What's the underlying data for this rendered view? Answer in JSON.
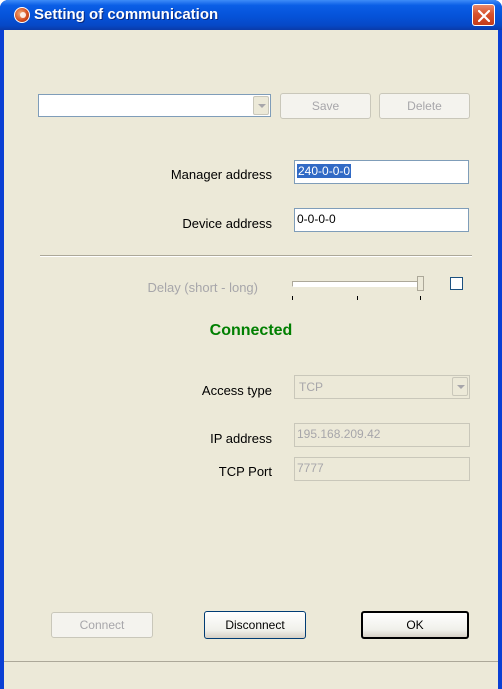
{
  "window": {
    "title": "Setting of communication"
  },
  "toolbar": {
    "profile_value": "",
    "save_label": "Save",
    "delete_label": "Delete"
  },
  "form": {
    "manager_address_label": "Manager address",
    "manager_address_value": "240-0-0-0",
    "device_address_label": "Device address",
    "device_address_value": "0-0-0-0",
    "delay_label": "Delay (short - long)",
    "delay_level": 1.0,
    "delay_checked": false,
    "status": "Connected",
    "access_type_label": "Access type",
    "access_type_value": "TCP",
    "ip_label": "IP address",
    "ip_value": "195.168.209.42",
    "tcp_port_label": "TCP Port",
    "tcp_port_value": "7777"
  },
  "footer": {
    "connect_label": "Connect",
    "disconnect_label": "Disconnect",
    "ok_label": "OK"
  },
  "colors": {
    "titlebar": "#0552d8",
    "dialog_bg": "#ece9d8",
    "status": "#007f00",
    "selection": "#316ac5"
  }
}
